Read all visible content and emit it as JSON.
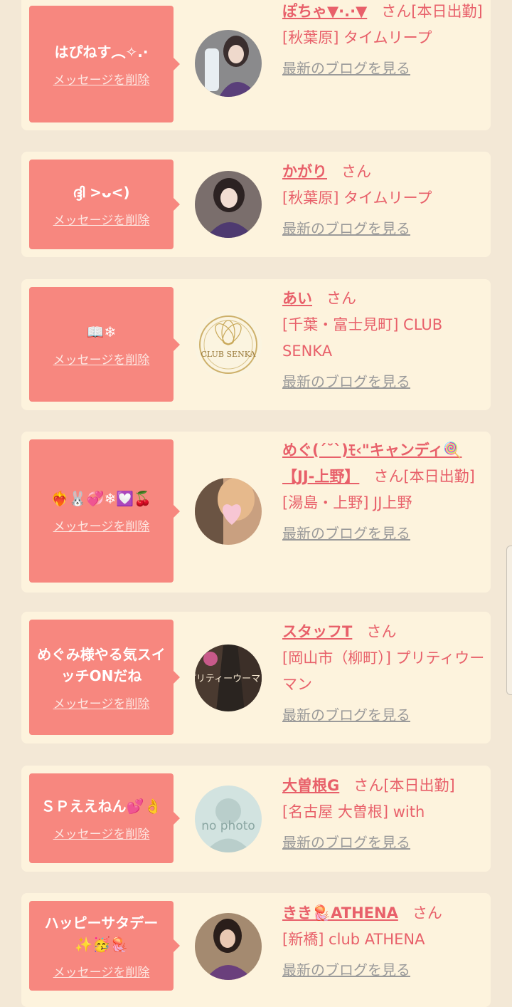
{
  "delete_label": "メッセージを削除",
  "blog_label": "最新のブログを見る",
  "san": "さん",
  "items": [
    {
      "message": "はぴねす︵✧.·",
      "name": "ぽちゃ▼·.·▼",
      "suffix": "[本日出勤]",
      "shop": "[秋葉原] タイムリープ",
      "avatar": "avatar-photo-girl-bottle"
    },
    {
      "message": "ദ്ദി >ᴗ<)",
      "name": "かがり",
      "suffix": "",
      "shop": "[秋葉原] タイムリープ",
      "avatar": "avatar-photo-girl-kimono"
    },
    {
      "message": "📖❄",
      "name": "あい",
      "suffix": "",
      "shop": "[千葉・富士見町] CLUB SENKA",
      "avatar": "club-senka-logo",
      "logo_text": "CLUB SENKA"
    },
    {
      "message": "❤️‍🔥🐰💞❄💟🍒",
      "name": "めぐ(ˊ˘ˋ)ﾓ‹\"キャンディ🍭【JJ-上野】",
      "suffix": "[本日出勤]",
      "shop": "[湯島・上野] JJ上野",
      "avatar": "avatar-photo-heart-blur"
    },
    {
      "message": "めぐみ様やる気スイッチONだね",
      "name": "スタッフT",
      "suffix": "",
      "shop": "[岡山市（柳町）] プリティウーマン",
      "avatar": "pretty-woman-logo",
      "logo_text": "プリティーウーマン"
    },
    {
      "message": "ＳＰええねん💕👌",
      "name": "大曽根G",
      "suffix": "[本日出勤]",
      "shop": "[名古屋 大曽根] with",
      "avatar": "no-photo-placeholder",
      "logo_text": "no photo"
    },
    {
      "message": "ハッピーサタデー✨🥳🪼",
      "name": "きき🪼ATHENA",
      "suffix": "",
      "shop": "[新橋] club ATHENA",
      "avatar": "avatar-photo-woman-dress"
    }
  ]
}
